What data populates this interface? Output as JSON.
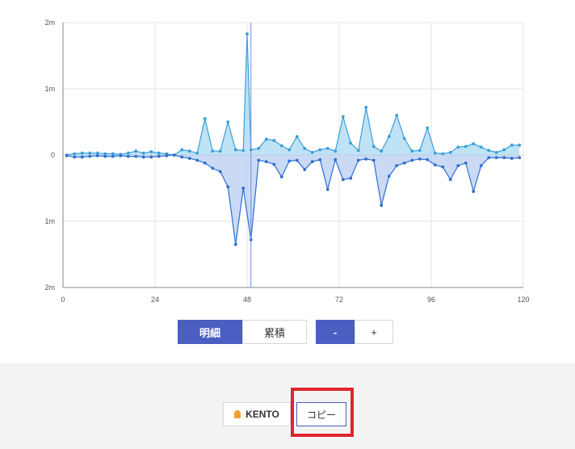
{
  "chart_data": {
    "type": "area",
    "xlim": [
      0,
      120
    ],
    "ylim": [
      -2,
      2
    ],
    "x_ticks": [
      "0",
      "24",
      "48",
      "72",
      "96",
      "120"
    ],
    "y_ticks": [
      "2m",
      "1m",
      "0",
      "1m",
      "2m"
    ],
    "y_tick_values": [
      2,
      1,
      0,
      -1,
      -2
    ],
    "grid": true,
    "cursor_x": 49,
    "series": [
      {
        "color": "#3a9fd8",
        "fill": "#a9d8f2",
        "x": [
          1,
          3,
          5,
          7,
          9,
          11,
          13,
          15,
          17,
          19,
          21,
          23,
          25,
          27,
          29,
          31,
          33,
          35,
          37,
          39,
          41,
          43,
          45,
          47,
          48,
          49,
          51,
          53,
          55,
          57,
          59,
          61,
          63,
          65,
          67,
          69,
          71,
          73,
          75,
          77,
          79,
          81,
          83,
          85,
          87,
          89,
          91,
          93,
          95,
          97,
          99,
          101,
          103,
          105,
          107,
          109,
          111,
          113,
          115,
          117,
          119
        ],
        "values": [
          0.0,
          0.02,
          0.03,
          0.03,
          0.03,
          0.02,
          0.02,
          0.01,
          0.03,
          0.06,
          0.03,
          0.05,
          0.03,
          0.02,
          0.0,
          0.08,
          0.06,
          0.03,
          0.55,
          0.06,
          0.06,
          0.5,
          0.08,
          0.07,
          1.83,
          0.08,
          0.1,
          0.24,
          0.22,
          0.14,
          0.08,
          0.28,
          0.1,
          0.04,
          0.08,
          0.1,
          0.06,
          0.58,
          0.18,
          0.07,
          0.72,
          0.13,
          0.06,
          0.28,
          0.6,
          0.25,
          0.06,
          0.07,
          0.41,
          0.03,
          0.02,
          0.04,
          0.12,
          0.13,
          0.17,
          0.12,
          0.07,
          0.04,
          0.08,
          0.15,
          0.15
        ]
      },
      {
        "color": "#2f6fd0",
        "fill": "#b8cdf0",
        "x": [
          1,
          3,
          5,
          7,
          9,
          11,
          13,
          15,
          17,
          19,
          21,
          23,
          25,
          27,
          29,
          31,
          33,
          35,
          37,
          39,
          41,
          43,
          45,
          47,
          49,
          51,
          53,
          55,
          57,
          59,
          61,
          63,
          65,
          67,
          69,
          71,
          73,
          75,
          77,
          79,
          81,
          83,
          85,
          87,
          89,
          91,
          93,
          95,
          97,
          99,
          101,
          103,
          105,
          107,
          109,
          111,
          113,
          115,
          117,
          119
        ],
        "values": [
          -0.01,
          -0.03,
          -0.03,
          -0.02,
          -0.01,
          -0.02,
          -0.02,
          -0.01,
          -0.02,
          -0.02,
          -0.03,
          -0.03,
          -0.02,
          -0.01,
          0.0,
          -0.03,
          -0.05,
          -0.08,
          -0.12,
          -0.2,
          -0.25,
          -0.48,
          -1.35,
          -0.5,
          -1.28,
          -0.08,
          -0.1,
          -0.14,
          -0.33,
          -0.09,
          -0.08,
          -0.22,
          -0.1,
          -0.07,
          -0.52,
          -0.07,
          -0.37,
          -0.35,
          -0.08,
          -0.06,
          -0.08,
          -0.76,
          -0.32,
          -0.16,
          -0.12,
          -0.08,
          -0.06,
          -0.07,
          -0.15,
          -0.18,
          -0.37,
          -0.16,
          -0.12,
          -0.55,
          -0.16,
          -0.04,
          -0.04,
          -0.04,
          -0.05,
          -0.04
        ]
      }
    ]
  },
  "controls": {
    "mode_detail": "明細",
    "mode_cumulative": "累積",
    "zoom_out": "-",
    "zoom_in": "+"
  },
  "footer": {
    "kento_label": "KENTO",
    "copy_label": "コピー"
  },
  "colors": {
    "accent": "#4a5fc1",
    "highlight": "#e0242e"
  }
}
